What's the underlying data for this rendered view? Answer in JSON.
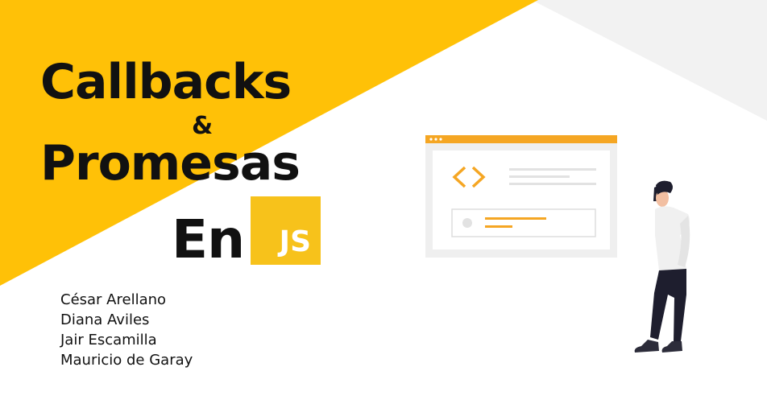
{
  "slide": {
    "title_line1": "Callbacks",
    "ampersand": "&",
    "title_line2": "Promesas",
    "title_line3": "En",
    "js_logo": "JS"
  },
  "authors": [
    "César Arellano",
    "Diana Aviles",
    "Jair Escamilla",
    "Mauricio de Garay"
  ],
  "colors": {
    "accent_yellow": "#ffc107",
    "logo_yellow": "#f7c21b",
    "gray_band": "#f2f2f2",
    "text": "#111111"
  },
  "icons": {
    "code": "code-brackets-icon",
    "illustration": "person-looking-at-browser-illustration"
  }
}
